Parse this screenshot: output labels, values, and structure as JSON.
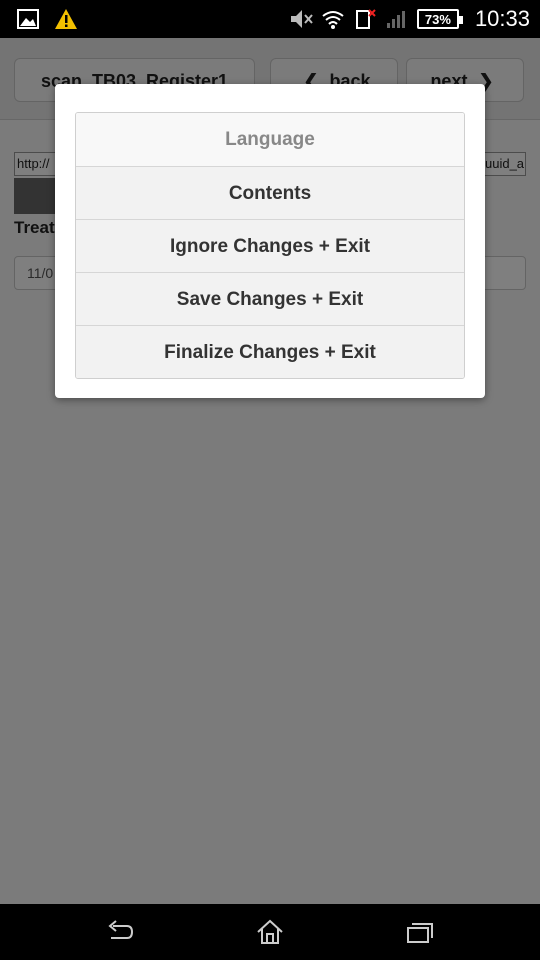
{
  "status_bar": {
    "battery": "73%",
    "time": "10:33",
    "icons": [
      "image-icon",
      "warning-icon",
      "mute-icon",
      "wifi-icon",
      "no-sim-icon",
      "signal-icon"
    ]
  },
  "header": {
    "form_name": "scan_TB03_Register1",
    "back_label": "back",
    "next_label": "next"
  },
  "content": {
    "url_left": "http://",
    "url_right": "uuid_a",
    "treat_label": "Treat",
    "date_value": "11/0"
  },
  "menu": {
    "items": [
      {
        "label": "Language"
      },
      {
        "label": "Contents"
      },
      {
        "label": "Ignore Changes + Exit"
      },
      {
        "label": "Save Changes + Exit"
      },
      {
        "label": "Finalize Changes + Exit"
      }
    ]
  },
  "colors": {
    "overlay": "#000000",
    "menu_bg": "#f2f2f2",
    "modal_bg": "#ffffff"
  }
}
